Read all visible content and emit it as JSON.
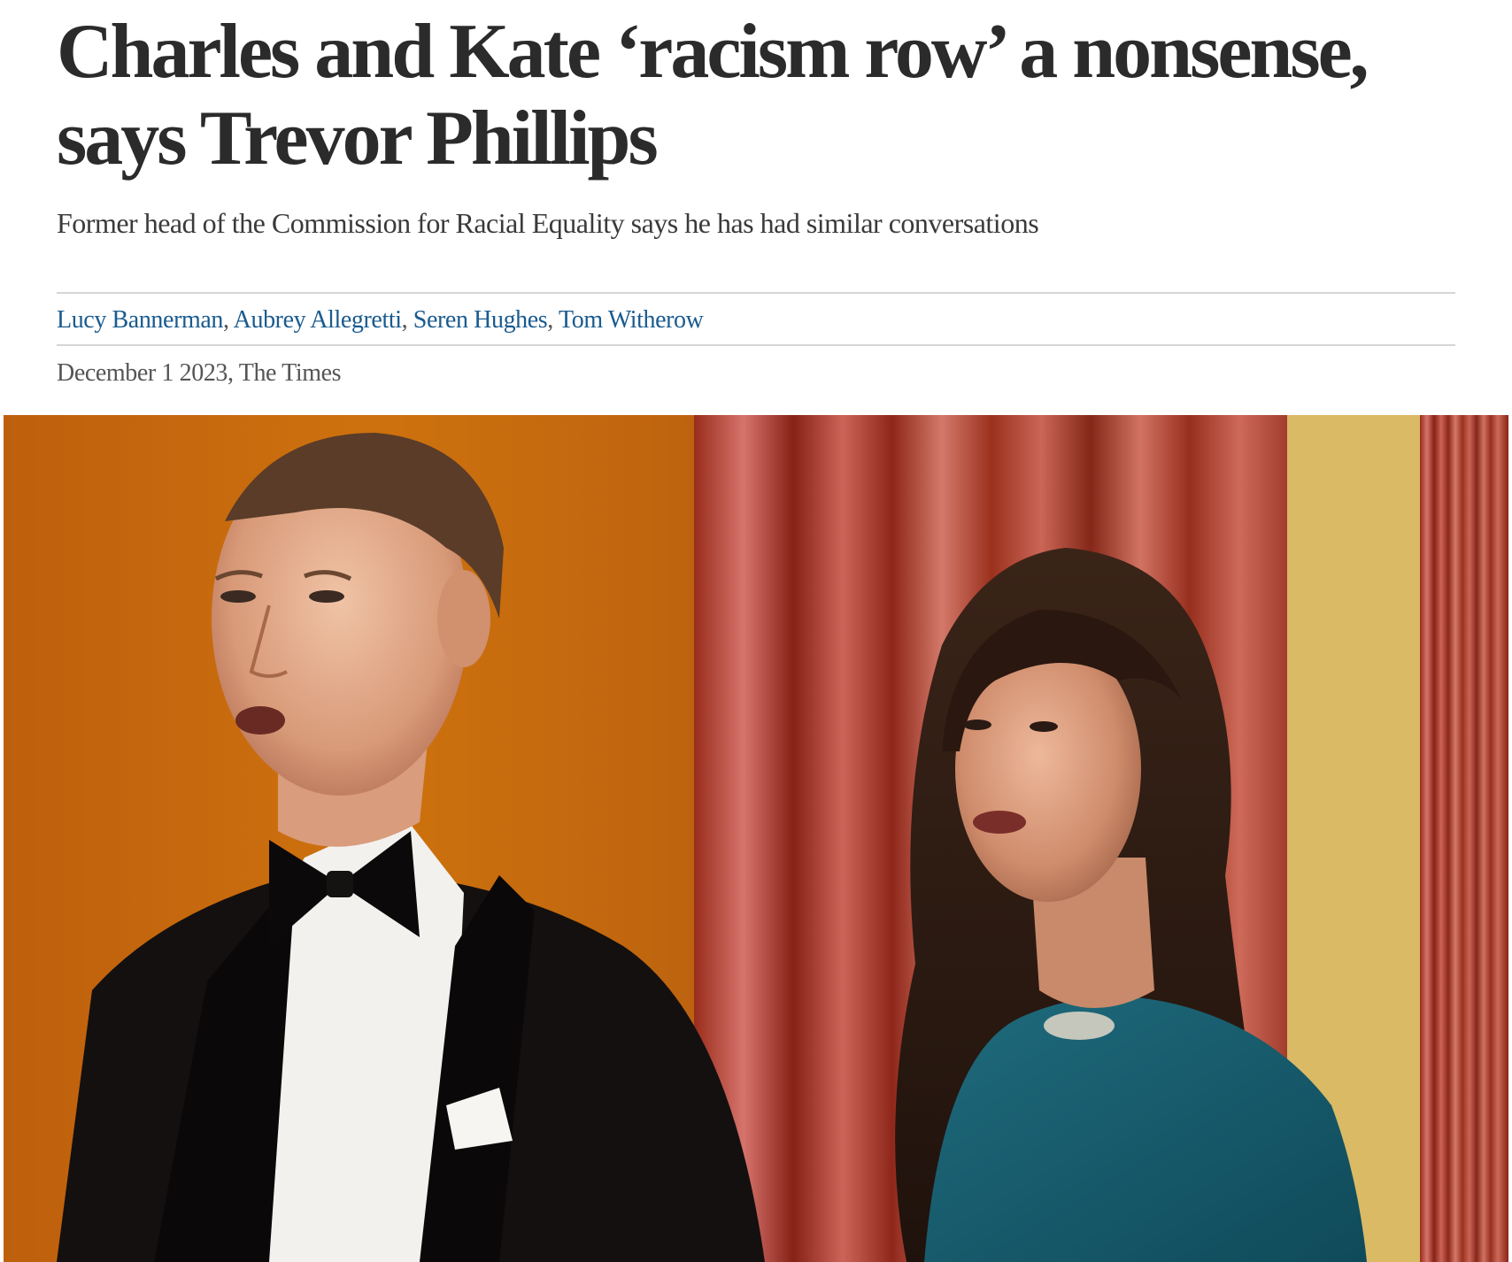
{
  "article": {
    "headline": "Charles and Kate ‘racism row’ a nonsense, says Trevor Phillips",
    "standfirst": "Former head of the Commission for Racial Equality says he has had similar conversations",
    "authors": [
      {
        "name": "Lucy Bannerman"
      },
      {
        "name": "Aubrey Allegretti"
      },
      {
        "name": "Seren Hughes"
      },
      {
        "name": "Tom Witherow"
      }
    ],
    "author_separator": ", ",
    "date": "December 1 2023",
    "publication": "The Times",
    "date_separator": ", "
  },
  "colors": {
    "author_link": "#1a5b8f",
    "headline_text": "#2b2b2b",
    "meta_text": "#555555",
    "rule": "#d6d6d6"
  },
  "hero_image": {
    "description_icon": "photo-icon"
  }
}
